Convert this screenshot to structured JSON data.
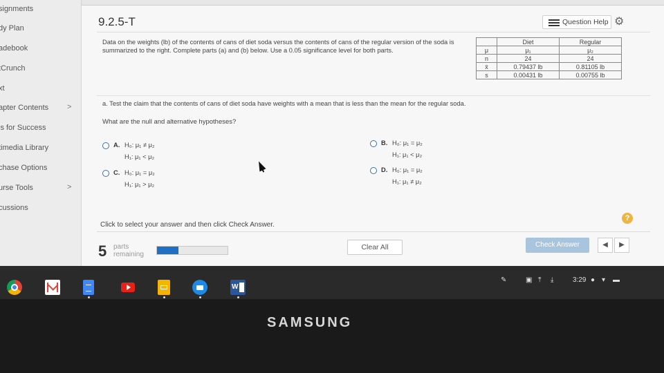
{
  "sidebar": {
    "items": [
      {
        "label": "signments",
        "chevron": ""
      },
      {
        "label": "dy Plan",
        "chevron": ""
      },
      {
        "label": "adebook",
        "chevron": ""
      },
      {
        "label": "tCrunch",
        "chevron": ""
      },
      {
        "label": "xt",
        "chevron": ""
      },
      {
        "label": "apter Contents",
        "chevron": ">"
      },
      {
        "label": "ls for Success",
        "chevron": ""
      },
      {
        "label": "timedia Library",
        "chevron": ""
      },
      {
        "label": "chase Options",
        "chevron": ""
      },
      {
        "label": "urse Tools",
        "chevron": ">"
      },
      {
        "label": "cussions",
        "chevron": ""
      }
    ]
  },
  "header": {
    "title": "9.2.5-T",
    "help_label": "Question Help"
  },
  "prompt": "Data on the weights (lb) of the contents of cans of diet soda versus the contents of cans of the regular version of the soda is summarized to the right. Complete parts (a) and (b) below. Use a 0.05 significance level for both parts.",
  "stats_table": {
    "headers": [
      "",
      "Diet",
      "Regular"
    ],
    "rows": [
      [
        "μ",
        "μ₁",
        "μ₂"
      ],
      [
        "n",
        "24",
        "24"
      ],
      [
        "x̄",
        "0.79437 lb",
        "0.81105 lb"
      ],
      [
        "s",
        "0.00431 lb",
        "0.00755 lb"
      ]
    ]
  },
  "part_a": "a. Test the claim that the contents of cans of diet soda have weights with a mean that is less than the mean for the regular soda.",
  "question": "What are the null and alternative hypotheses?",
  "options": [
    {
      "letter": "A.",
      "h0": "H₀: μ₁ ≠ μ₂",
      "h1": "H₁: μ₁ < μ₂"
    },
    {
      "letter": "B.",
      "h0": "H₀: μ₁ = μ₂",
      "h1": "H₁: μ₁ < μ₂"
    },
    {
      "letter": "C.",
      "h0": "H₀: μ₁ = μ₂",
      "h1": "H₁: μ₁ > μ₂"
    },
    {
      "letter": "D.",
      "h0": "H₀: μ₁ = μ₂",
      "h1": "H₁: μ₁ ≠ μ₂"
    }
  ],
  "help_circle": "?",
  "instruction": "Click to select your answer and then click Check Answer.",
  "footer": {
    "parts_count": "5",
    "parts_label_1": "parts",
    "parts_label_2": "remaining",
    "progress_fraction": 0.3,
    "clear_label": "Clear All",
    "check_label": "Check Answer",
    "prev_label": "◀",
    "next_label": "▶"
  },
  "shelf": {
    "word_letter": "W",
    "clock": "3:29"
  },
  "brand": "SAMSUNG",
  "colors": {
    "accent": "#1f6fc4",
    "check_button": "#a9c4dd",
    "help_circle": "#f0b440"
  }
}
